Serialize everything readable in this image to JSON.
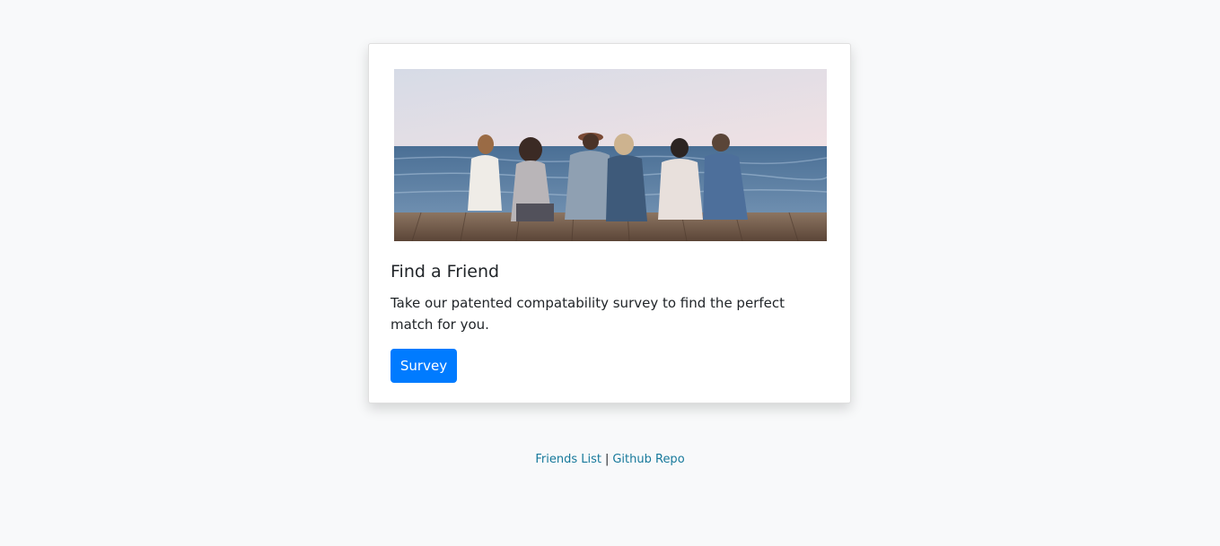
{
  "card": {
    "title": "Find a Friend",
    "text": "Take our patented compatability survey to find the perfect match for you.",
    "button_label": "Survey"
  },
  "footer": {
    "links": [
      {
        "label": "Friends List"
      },
      {
        "label": "Github Repo"
      }
    ],
    "separator": "|"
  },
  "colors": {
    "page_background": "#f8f9fa",
    "primary_button": "#007bff",
    "link": "#17799b"
  }
}
